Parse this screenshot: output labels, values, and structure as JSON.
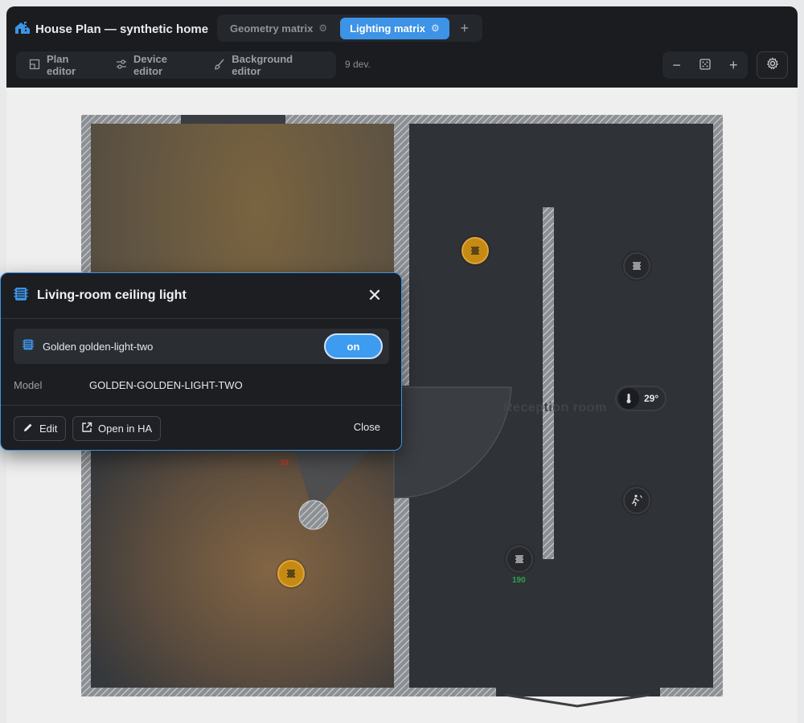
{
  "app": {
    "title": "House Plan — synthetic home",
    "logo_icon": "house-plan-icon"
  },
  "tabs": [
    {
      "label": "Geometry matrix",
      "active": false
    },
    {
      "label": "Lighting matrix",
      "active": true
    }
  ],
  "tab_add_label": "+",
  "toolbar": {
    "plan_editor": "Plan editor",
    "device_editor": "Device editor",
    "background_editor": "Background editor",
    "device_count": "9 dev."
  },
  "zoom": {
    "minus": "−",
    "plus": "+"
  },
  "plan": {
    "room_label": "Reception room",
    "temperature": "29°",
    "device_values": [
      "190",
      "39"
    ]
  },
  "dialog": {
    "title": "Living-room ceiling light",
    "entity_name": "Golden golden-light-two",
    "state": "on",
    "model_label": "Model",
    "model_value": "GOLDEN-GOLDEN-LIGHT-TWO",
    "edit_label": "Edit",
    "open_ha_label": "Open in HA",
    "close_label": "Close"
  },
  "colors": {
    "accent": "#3d93e6",
    "light_on": "#c48a12",
    "dark_bg": "#1a1c20"
  }
}
